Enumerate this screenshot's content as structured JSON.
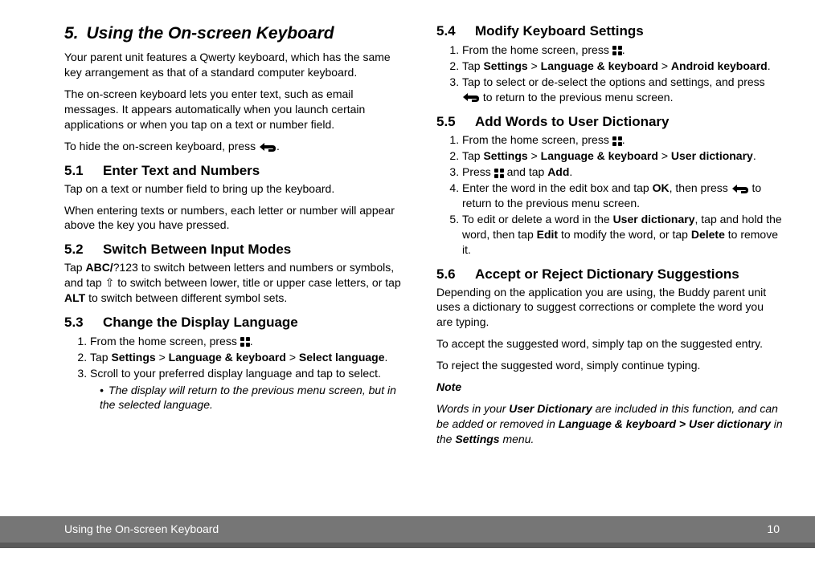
{
  "title": {
    "num": "5.",
    "text": "Using the On-screen Keyboard"
  },
  "intro": [
    "Your parent unit features a Qwerty keyboard, which has the same key arrangement as that of a standard computer keyboard.",
    "The on-screen keyboard lets you enter text, such as email messages. It appears automatically when you launch certain applications or when you tap on a text or number field."
  ],
  "hide_prefix": "To hide the on-screen keyboard, press ",
  "hide_suffix": ".",
  "s51": {
    "num": "5.1",
    "title": "Enter Text and Numbers",
    "p1": "Tap on a text or number field to bring up the keyboard.",
    "p2": "When entering texts or numbers, each letter or number will appear above the key you have pressed."
  },
  "s52": {
    "num": "5.2",
    "title": "Switch Between Input Modes",
    "t1": "Tap ",
    "b1": "ABC/",
    "t2": "?123 to switch between letters and numbers or symbols, and tap ⇧ to switch between lower, title or upper case letters, or tap ",
    "b2": "ALT",
    "t3": " to switch between different symbol sets."
  },
  "s53": {
    "num": "5.3",
    "title": "Change the Display Language",
    "li1a": "From the home screen, press ",
    "li1b": ".",
    "li2a": "Tap ",
    "b_settings": "Settings",
    "gt": " > ",
    "b_lang": "Language & keyboard",
    "b_sel": "Select language",
    "li2b": ".",
    "li3": "Scroll to your preferred display language and tap to select.",
    "bullet": "The display will return to the previous menu screen, but in the selected language."
  },
  "s54": {
    "num": "5.4",
    "title": "Modify Keyboard Settings",
    "li1a": "From the home screen, press ",
    "li1b": ".",
    "li2a": "Tap ",
    "b_android": "Android keyboard",
    "li2b": ".",
    "li3a": "Tap to select or de-select the options and settings, and press ",
    "li3b": " to return to the previous menu screen."
  },
  "s55": {
    "num": "5.5",
    "title": "Add Words to User Dictionary",
    "li1a": "From the home screen, press ",
    "li1b": ".",
    "li2a": "Tap ",
    "b_user": "User dictionary",
    "li2b": ".",
    "li3a": "Press ",
    "li3b": " and tap ",
    "b_add": "Add",
    "li3c": ".",
    "li4a": "Enter the word in the edit box and tap ",
    "b_ok": "OK",
    "li4b": ", then press ",
    "li4c": " to return to the previous menu screen.",
    "li5a": "To edit or delete a word in the ",
    "b_ud": "User dictionary",
    "li5b": ", tap and hold the word, then tap ",
    "b_edit": "Edit",
    "li5c": " to modify the word, or tap ",
    "b_del": "Delete",
    "li5d": " to remove it."
  },
  "s56": {
    "num": "5.6",
    "title": "Accept or Reject Dictionary Suggestions",
    "p1": "Depending on the application you are using, the Buddy parent unit uses a dictionary to suggest corrections or complete the word you are typing.",
    "p2": "To accept the suggested word, simply tap on the suggested entry.",
    "p3": "To reject the suggested word, simply continue typing.",
    "note_hd": "Note",
    "note_a": "Words in your ",
    "note_b1": "User Dictionary",
    "note_b": " are included in this function, and can be added or removed in ",
    "note_b2": "Language & keyboard > User dictionary",
    "note_c": " in the ",
    "note_b3": "Settings",
    "note_d": " menu."
  },
  "footer": {
    "left": "Using the On-screen Keyboard",
    "right": "10"
  }
}
